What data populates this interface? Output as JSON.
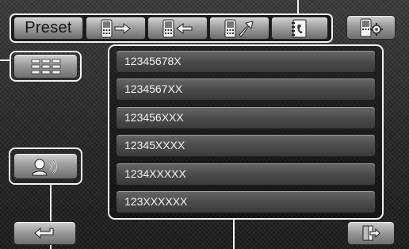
{
  "top_bar": {
    "preset_label": "Preset",
    "buttons": [
      {
        "icon": "phone-send-icon"
      },
      {
        "icon": "phone-receive-icon"
      },
      {
        "icon": "phone-missed-icon"
      },
      {
        "icon": "phonebook-icon"
      }
    ]
  },
  "settings_button": {
    "icon": "phone-settings-icon"
  },
  "side": {
    "keypad_button": {
      "icon": "keypad-icon"
    },
    "voice_button": {
      "icon": "voice-dial-icon"
    }
  },
  "number_list": [
    "12345678X",
    "1234567XX",
    "123456XXX",
    "12345XXXX",
    "1234XXXXX",
    "123XXXXXX"
  ],
  "bottom": {
    "back_button": {
      "icon": "back-arrow-icon"
    },
    "exit_button": {
      "icon": "exit-icon"
    }
  }
}
